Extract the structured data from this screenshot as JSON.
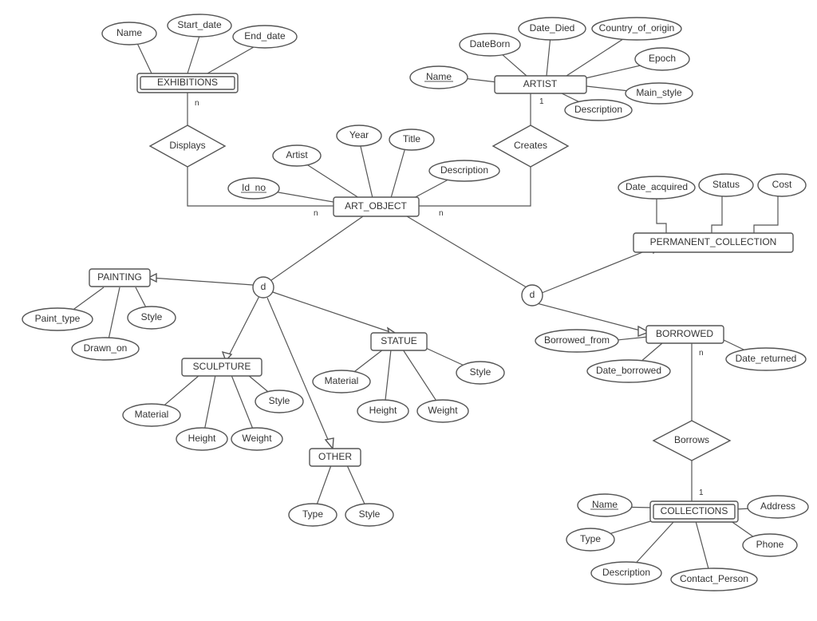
{
  "diagram_type": "Entity-Relationship Diagram (Chen notation) — Museum / Art Database",
  "entities": {
    "art_object": "ART_OBJECT",
    "exhibitions": "EXHIBITIONS",
    "artist": "ARTIST",
    "permanent_collection": "PERMANENT_COLLECTION",
    "borrowed": "BORROWED",
    "collections": "COLLECTIONS",
    "painting": "PAINTING",
    "sculpture": "SCULPTURE",
    "statue": "STATUE",
    "other": "OTHER"
  },
  "relationships": {
    "displays": "Displays",
    "creates": "Creates",
    "borrows": "Borrows"
  },
  "specialization": {
    "left": "d",
    "right": "d"
  },
  "attributes": {
    "exh_name": "Name",
    "exh_start": "Start_date",
    "exh_end": "End_date",
    "art_name": "Name",
    "art_dborn": "DateBorn",
    "art_ddied": "Date_Died",
    "art_country": "Country_of_origin",
    "art_epoch": "Epoch",
    "art_mainstyle": "Main_style",
    "art_desc": "Description",
    "ao_id": "Id_no",
    "ao_artist": "Artist",
    "ao_year": "Year",
    "ao_title": "Title",
    "ao_desc": "Description",
    "pc_date": "Date_acquired",
    "pc_status": "Status",
    "pc_cost": "Cost",
    "bo_from": "Borrowed_from",
    "bo_dborr": "Date_borrowed",
    "bo_dretu": "Date_returned",
    "col_name": "Name",
    "col_type": "Type",
    "col_desc": "Description",
    "col_contact": "Contact_Person",
    "col_phone": "Phone",
    "col_addr": "Address",
    "p_ptype": "Paint_type",
    "p_style": "Style",
    "p_drawn": "Drawn_on",
    "s_mat": "Material",
    "s_ht": "Height",
    "s_wt": "Weight",
    "s_style": "Style",
    "st_mat": "Material",
    "st_ht": "Height",
    "st_wt": "Weight",
    "st_style": "Style",
    "o_type": "Type",
    "o_style": "Style"
  },
  "cardinalities": {
    "exh_side": "n",
    "ao_exh_side": "n",
    "ao_creates_side": "n",
    "artist_side": "1",
    "borrowed_side": "n",
    "collections_side": "1"
  }
}
